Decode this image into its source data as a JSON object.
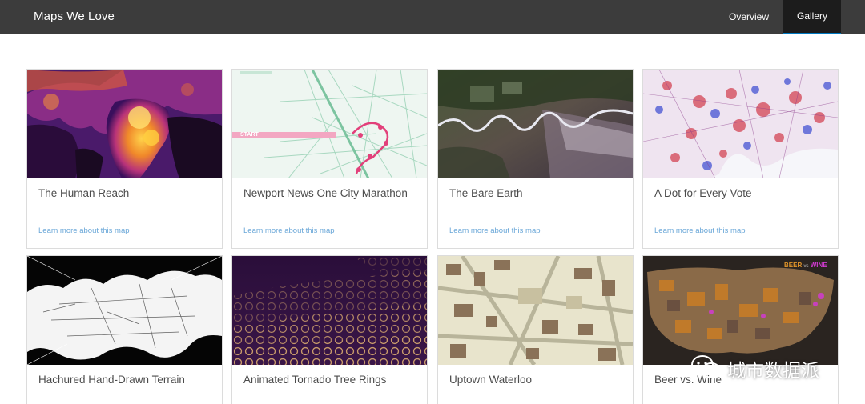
{
  "header": {
    "title": "Maps We Love",
    "nav": [
      {
        "label": "Overview",
        "active": false
      },
      {
        "label": "Gallery",
        "active": true
      }
    ],
    "accent_color": "#0079c1"
  },
  "gallery": {
    "cards": [
      {
        "title": "The Human Reach",
        "link": "Learn more about this map"
      },
      {
        "title": "Newport News One City Marathon",
        "link": "Learn more about this map",
        "start_label": "START"
      },
      {
        "title": "The Bare Earth",
        "link": "Learn more about this map"
      },
      {
        "title": "A Dot for Every Vote",
        "link": "Learn more about this map"
      },
      {
        "title": "Hachured Hand-Drawn Terrain"
      },
      {
        "title": "Animated Tornado Tree Rings"
      },
      {
        "title": "Uptown Waterloo"
      },
      {
        "title": "Beer vs. Wine",
        "map_label_1": "BEER",
        "map_label_2": "vs",
        "map_label_3": "WINE"
      }
    ]
  },
  "watermark": {
    "text": "城市数据派",
    "icon": "wechat-icon"
  }
}
